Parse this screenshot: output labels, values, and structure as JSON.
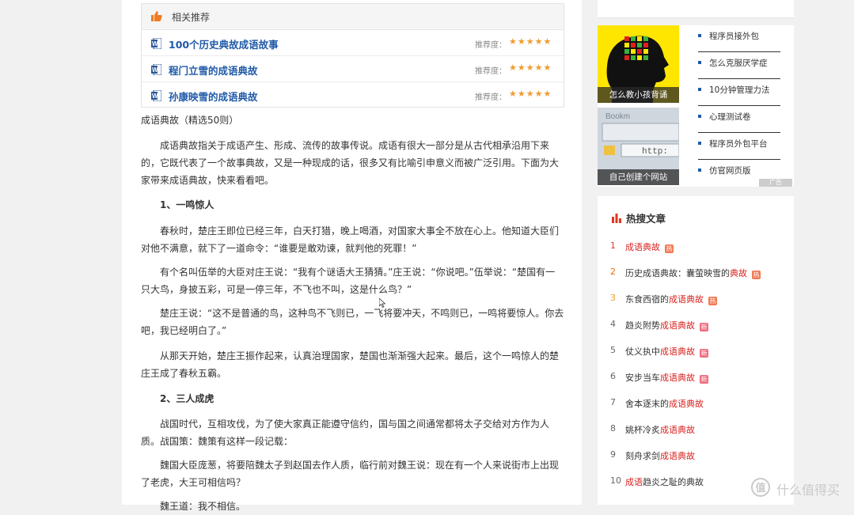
{
  "recommend": {
    "title": "相关推荐",
    "items": [
      {
        "title": "100个历史典故成语故事",
        "label": "推荐度：",
        "stars": "★★★★★"
      },
      {
        "title": "程门立雪的成语典故",
        "label": "推荐度：",
        "stars": "★★★★★"
      },
      {
        "title": "孙康映雪的成语典故",
        "label": "推荐度：",
        "stars": "★★★★★"
      }
    ]
  },
  "article": {
    "doc_title": "成语典故（精选50则）",
    "intro": "成语典故指关于成语产生、形成、流传的故事传说。成语有很大一部分是从古代相承沿用下来的，它既代表了一个故事典故，又是一种现成的话，很多又有比喻引申意义而被广泛引用。下面为大家带来成语典故，快来看看吧。",
    "h1": "1、一鸣惊人",
    "p1": "春秋时，楚庄王即位已经三年，白天打猎，晚上喝酒，对国家大事全不放在心上。他知道大臣们对他不满意，就下了一道命令：“谁要是敢劝谏，就判他的死罪！”",
    "p2": "有个名叫伍举的大臣对庄王说：“我有个谜语大王猜猜。”庄王说：“你说吧。”伍举说：“楚国有一只大鸟，身披五彩，可是一停三年，不飞也不叫，这是什么鸟？”",
    "p3": "楚庄王说：“这不是普通的鸟，这种鸟不飞则已，一飞将要冲天，不鸣则已，一鸣将要惊人。你去吧，我已经明白了。”",
    "p4": "从那天开始，楚庄王振作起来，认真治理国家，楚国也渐渐强大起来。最后，这个一鸣惊人的楚庄王成了春秋五霸。",
    "h2": "2、三人成虎",
    "p5": "战国时代，互相攻伐，为了使大家真正能遵守信约，国与国之间通常都将太子交给对方作为人质。战国策：魏策有这样一段记载：",
    "p6": "魏国大臣庞葱，将要陪魏太子到赵国去作人质，临行前对魏王说：现在有一个人来说街市上出现了老虎，大王可相信吗？",
    "p7": "魏王道：我不相信。"
  },
  "sidebar": {
    "ads": [
      {
        "caption": "怎么教小孩背诵"
      },
      {
        "caption": "自己创建个网站"
      }
    ],
    "ad_links": [
      "程序员接外包",
      "怎么克服厌学症",
      "10分钟管理力法",
      "心理测试卷",
      "程序员外包平台",
      "仿官网页版"
    ],
    "ad_mark": "广告"
  },
  "hot": {
    "title": "热搜文章",
    "items": [
      {
        "n": "1",
        "pre": "",
        "hl": "成语典故",
        "post": "",
        "badge": "热",
        "badge_type": "hot"
      },
      {
        "n": "2",
        "pre": "历史成语典故：囊萤映雪的",
        "hl": "典故",
        "post": "",
        "badge": "热",
        "badge_type": "hot"
      },
      {
        "n": "3",
        "pre": "东食西宿的",
        "hl": "成语典故",
        "post": "",
        "badge": "热",
        "badge_type": "hot"
      },
      {
        "n": "4",
        "pre": "趋炎附势",
        "hl": "成语典故",
        "post": "",
        "badge": "新",
        "badge_type": "new"
      },
      {
        "n": "5",
        "pre": "仗义执中",
        "hl": "成语典故",
        "post": "",
        "badge": "新",
        "badge_type": "new"
      },
      {
        "n": "6",
        "pre": "安步当车",
        "hl": "成语典故",
        "post": "",
        "badge": "新",
        "badge_type": "new"
      },
      {
        "n": "7",
        "pre": "舍本逐末的",
        "hl": "成语典故",
        "post": "",
        "badge": "",
        "badge_type": ""
      },
      {
        "n": "8",
        "pre": "姚杯冷炙",
        "hl": "成语典故",
        "post": "",
        "badge": "",
        "badge_type": ""
      },
      {
        "n": "9",
        "pre": "刻舟求剑",
        "hl": "成语典故",
        "post": "",
        "badge": "",
        "badge_type": ""
      },
      {
        "n": "10",
        "pre": "",
        "hl": "成语",
        "post": "趋炎之耻的典故",
        "badge": "",
        "badge_type": ""
      }
    ]
  },
  "watermark": "什么值得买",
  "colors": {
    "link_blue": "#1f5aa8",
    "hot_red": "#d8221f",
    "star_orange": "#f29a2e"
  }
}
